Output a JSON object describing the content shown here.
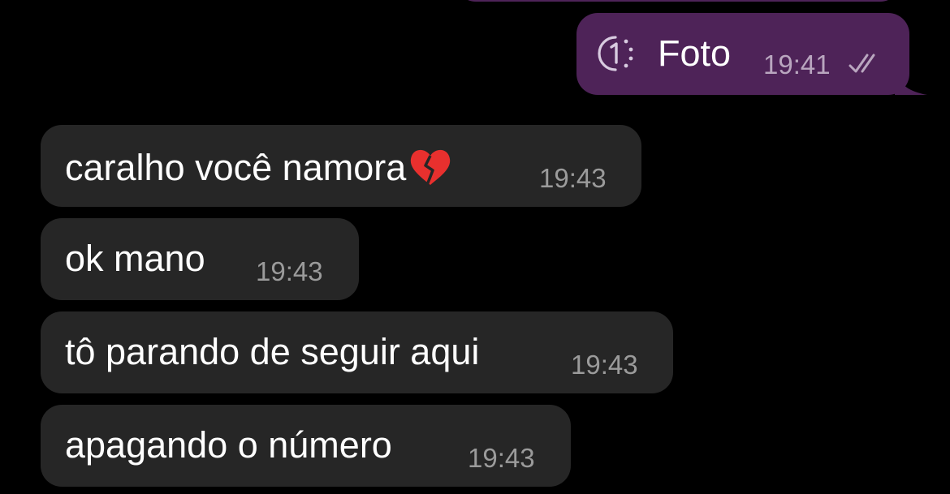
{
  "colors": {
    "background": "#000000",
    "outgoing_bubble": "#4e2358",
    "incoming_bubble": "#262626",
    "time_incoming": "#9b9b9b",
    "time_outgoing": "#b9a6bf",
    "heart_red": "#e8302e"
  },
  "outgoing": [
    {
      "icon": "view-once-icon",
      "text": "Foto",
      "time": "19:41",
      "status_icon": "double-check-icon"
    }
  ],
  "incoming": [
    {
      "text": "caralho você namora",
      "emoji": "broken-heart-icon",
      "time": "19:43"
    },
    {
      "text": "ok mano",
      "time": "19:43"
    },
    {
      "text": "tô parando de seguir aqui",
      "time": "19:43"
    },
    {
      "text": "apagando o número",
      "time": "19:43"
    }
  ]
}
